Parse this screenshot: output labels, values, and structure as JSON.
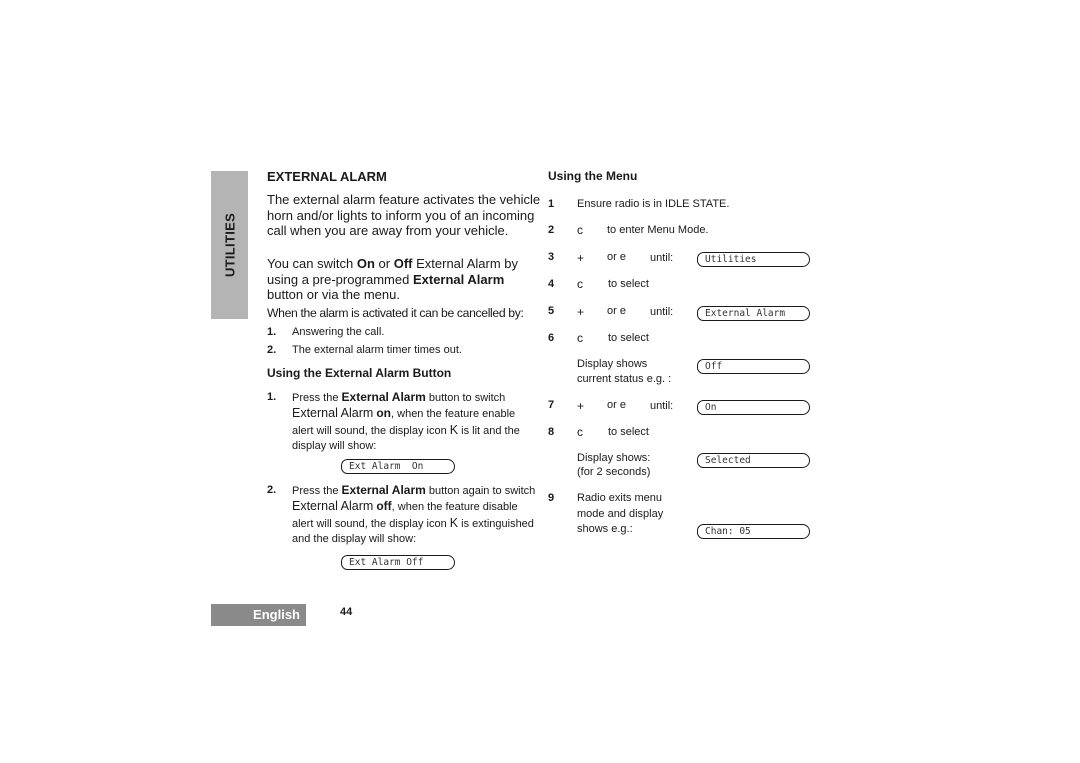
{
  "section_tab": "UTILITIES",
  "title": "EXTERNAL ALARM",
  "intro": "The external alarm feature activates the vehicle horn and/or lights to inform you of an incoming call when you are away from your vehicle.",
  "switch_para": {
    "pre": "You can switch ",
    "on": "On",
    "mid": " or ",
    "off": "Off",
    "mid2": " External Alarm by using a pre-programmed ",
    "button": "External Alarm",
    "post": " button or via the menu."
  },
  "cancel_intro": "When the alarm is activated it can be cancelled by:",
  "cancel_list": [
    {
      "num": "1.",
      "text": "Answering the call."
    },
    {
      "num": "2.",
      "text": "The external alarm timer times out."
    }
  ],
  "button_section": {
    "heading": "Using the External Alarm Button",
    "steps": [
      {
        "num": "1.",
        "pre": "Press the ",
        "bold": "External Alarm",
        "mid": " button to switch ",
        "feature": "External Alarm",
        "state": "on",
        "post": ", when the feature enable alert will sound, the display icon ",
        "icon": "K",
        "post2": "  is lit  and the display will show:",
        "display": "Ext Alarm  On"
      },
      {
        "num": "2.",
        "pre": "Press the ",
        "bold": "External Alarm",
        "mid": " button again to switch ",
        "feature": "External Alarm",
        "state": "off",
        "post": ", when the feature disable alert will sound, the display icon ",
        "icon": "K",
        "post2": "  is extinguished and the display will show:",
        "display": "Ext Alarm Off"
      }
    ]
  },
  "menu_section": {
    "heading": "Using the Menu",
    "steps": [
      {
        "num": "1",
        "text": "Ensure radio is in IDLE STATE."
      },
      {
        "num": "2",
        "key": "c",
        "text": "to enter Menu Mode."
      },
      {
        "num": "3",
        "key": "+",
        "alt": "or e",
        "until": "until:",
        "display": "Utilities"
      },
      {
        "num": "4",
        "key": "c",
        "text": "to select"
      },
      {
        "num": "5",
        "key": "+",
        "alt": "or e",
        "until": "until:",
        "display": "External Alarm"
      },
      {
        "num": "6",
        "key": "c",
        "text": "to select"
      },
      {
        "num": "",
        "text_line1": "Display shows",
        "text_line2": "current status e.g. :",
        "display": "Off"
      },
      {
        "num": "7",
        "key": "+",
        "alt": "or e",
        "until": "until:",
        "display": "On"
      },
      {
        "num": "8",
        "key": "c",
        "text": "to select"
      },
      {
        "num": "",
        "text_line1": "Display shows:",
        "text_line2": "(for 2 seconds)",
        "display": "Selected"
      },
      {
        "num": "9",
        "text_line1": "Radio exits menu",
        "text_line2": "mode and display",
        "text_line3": "shows e.g.:",
        "display": "Chan: 05"
      }
    ]
  },
  "footer": {
    "language": "English",
    "page_number": "44"
  }
}
